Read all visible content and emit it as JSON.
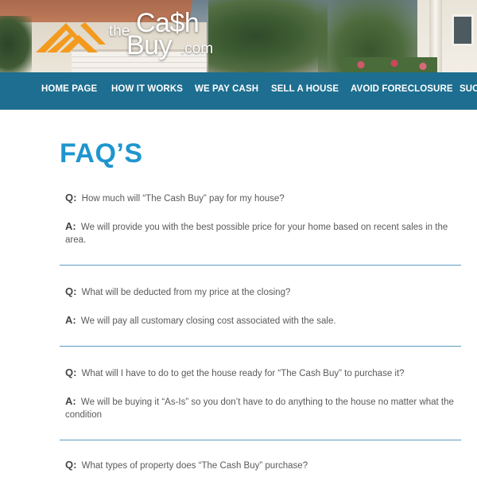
{
  "logo": {
    "the": "the",
    "cash": "Ca$h",
    "buy": "Buy",
    "com": ".com",
    "accent_color": "#f39a1e"
  },
  "nav": {
    "items": [
      {
        "label": "HOME PAGE"
      },
      {
        "label": "HOW IT WORKS"
      },
      {
        "label": "WE PAY CASH"
      },
      {
        "label": "SELL A HOUSE"
      },
      {
        "label": "AVOID FORECLOSURE"
      },
      {
        "label": "SUC"
      }
    ],
    "background": "#1d6e90"
  },
  "page": {
    "title": "FAQ’S",
    "title_color": "#1f95cf"
  },
  "faqs": [
    {
      "q_lead": "Q:",
      "question": "How much will “The Cash Buy” pay for my house?",
      "a_lead": "A:",
      "answer_line1": "We will provide you with the best possible price for your home based on recent sales in the",
      "answer_line2": "area."
    },
    {
      "q_lead": "Q:",
      "question": "What will be deducted from my price at the closing?",
      "a_lead": "A:",
      "answer_line1": "We will pay all customary closing cost associated with the sale.",
      "answer_line2": ""
    },
    {
      "q_lead": "Q:",
      "question": "What will I have to do to get the house ready for “The Cash Buy” to purchase it?",
      "a_lead": "A:",
      "answer_line1": "We will be buying it “As-Is” so you don’t have to do anything to the house no matter what the",
      "answer_line2": "condition"
    },
    {
      "q_lead": "Q:",
      "question": "What types of property does “The Cash Buy” purchase?"
    }
  ]
}
